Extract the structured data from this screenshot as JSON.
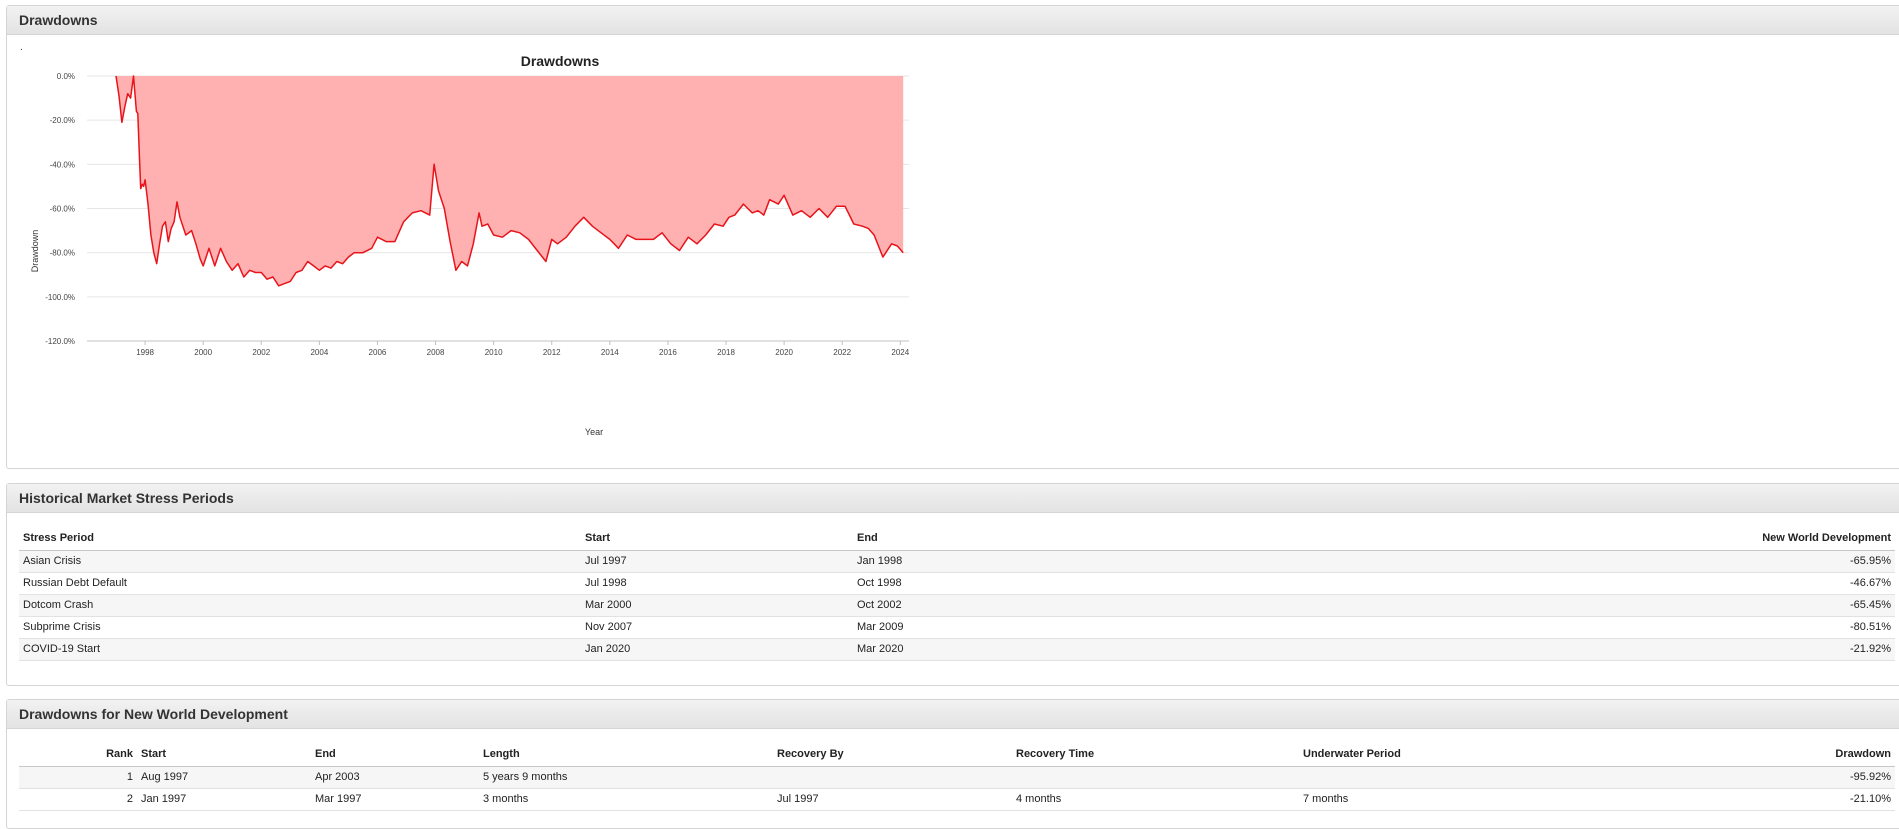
{
  "panels": {
    "drawdowns_title": "Drawdowns",
    "stress_title": "Historical Market Stress Periods",
    "dd_table_title": "Drawdowns for New World Development"
  },
  "chart_marker": ".",
  "chart_data": {
    "type": "area",
    "title": "Drawdowns",
    "xlabel": "Year",
    "ylabel": "Drawdown",
    "ylim": [
      -120,
      0
    ],
    "xlim": [
      1996.0,
      2024.3
    ],
    "y_ticks": [
      0,
      -20,
      -40,
      -60,
      -80,
      -100,
      -120
    ],
    "y_tick_labels": [
      "0.0%",
      "-20.0%",
      "-40.0%",
      "-60.0%",
      "-80.0%",
      "-100.0%",
      "-120.0%"
    ],
    "x_ticks": [
      1998,
      2000,
      2002,
      2004,
      2006,
      2008,
      2010,
      2012,
      2014,
      2016,
      2018,
      2020,
      2022,
      2024
    ],
    "x_tick_labels": [
      "1998",
      "2000",
      "2002",
      "2004",
      "2006",
      "2008",
      "2010",
      "2012",
      "2014",
      "2016",
      "2018",
      "2020",
      "2022",
      "2024"
    ],
    "grid": true,
    "line_color": "#e8141b",
    "fill_color": "#ffb0b0",
    "series": [
      {
        "x": [
          1997.0,
          1997.1,
          1997.2,
          1997.3,
          1997.4,
          1997.5,
          1997.6,
          1997.7,
          1997.75,
          1997.8,
          1997.85,
          1997.9,
          1997.95,
          1998.0,
          1998.1,
          1998.2,
          1998.3,
          1998.4,
          1998.5,
          1998.6,
          1998.7,
          1998.8,
          1998.9,
          1999.0,
          1999.1,
          1999.2,
          1999.4,
          1999.6,
          1999.75,
          1999.9,
          2000.0,
          2000.2,
          2000.4,
          2000.6,
          2000.8,
          2001.0,
          2001.2,
          2001.4,
          2001.6,
          2001.8,
          2002.0,
          2002.2,
          2002.4,
          2002.6,
          2002.8,
          2003.0,
          2003.2,
          2003.4,
          2003.6,
          2003.8,
          2004.0,
          2004.2,
          2004.4,
          2004.6,
          2004.8,
          2005.0,
          2005.2,
          2005.5,
          2005.8,
          2006.0,
          2006.3,
          2006.6,
          2006.9,
          2007.2,
          2007.5,
          2007.8,
          2007.95,
          2008.1,
          2008.3,
          2008.5,
          2008.7,
          2008.9,
          2009.1,
          2009.3,
          2009.5,
          2009.6,
          2009.8,
          2010.0,
          2010.3,
          2010.6,
          2010.9,
          2011.2,
          2011.5,
          2011.8,
          2012.0,
          2012.2,
          2012.5,
          2012.8,
          2013.1,
          2013.4,
          2013.7,
          2014.0,
          2014.3,
          2014.6,
          2014.9,
          2015.2,
          2015.5,
          2015.8,
          2016.1,
          2016.4,
          2016.7,
          2017.0,
          2017.3,
          2017.6,
          2017.9,
          2018.1,
          2018.3,
          2018.6,
          2018.9,
          2019.1,
          2019.3,
          2019.5,
          2019.8,
          2020.0,
          2020.3,
          2020.6,
          2020.9,
          2021.2,
          2021.5,
          2021.8,
          2022.1,
          2022.4,
          2022.7,
          2022.9,
          2023.1,
          2023.4,
          2023.7,
          2023.9,
          2024.1
        ],
        "y": [
          0,
          -9,
          -21,
          -14,
          -8,
          -10,
          0,
          -16,
          -17,
          -35,
          -51,
          -49,
          -50,
          -47,
          -58,
          -72,
          -80,
          -85,
          -76,
          -68,
          -66,
          -75,
          -69,
          -66,
          -57,
          -64,
          -72,
          -70,
          -76,
          -83,
          -86,
          -78,
          -86,
          -78,
          -84,
          -88,
          -85,
          -91,
          -88,
          -89,
          -89,
          -92,
          -91,
          -95,
          -94,
          -93,
          -89,
          -88,
          -84,
          -86,
          -88,
          -86,
          -87,
          -84,
          -85,
          -82,
          -80,
          -80,
          -78,
          -73,
          -75,
          -75,
          -66,
          -62,
          -61,
          -63,
          -40,
          -52,
          -60,
          -75,
          -88,
          -84,
          -86,
          -76,
          -62,
          -68,
          -67,
          -72,
          -73,
          -70,
          -71,
          -74,
          -79,
          -84,
          -74,
          -76,
          -73,
          -68,
          -64,
          -68,
          -71,
          -74,
          -78,
          -72,
          -74,
          -74,
          -74,
          -71,
          -76,
          -79,
          -73,
          -76,
          -72,
          -67,
          -68,
          -64,
          -63,
          -58,
          -62,
          -61,
          -63,
          -56,
          -58,
          -54,
          -63,
          -61,
          -64,
          -60,
          -64,
          -59,
          -59,
          -67,
          -68,
          -69,
          -72,
          -82,
          -76,
          -77,
          -80
        ]
      }
    ]
  },
  "stress_table": {
    "headers": [
      "Stress Period",
      "Start",
      "End",
      "New World Development"
    ],
    "rows": [
      [
        "Asian Crisis",
        "Jul 1997",
        "Jan 1998",
        "-65.95%"
      ],
      [
        "Russian Debt Default",
        "Jul 1998",
        "Oct 1998",
        "-46.67%"
      ],
      [
        "Dotcom Crash",
        "Mar 2000",
        "Oct 2002",
        "-65.45%"
      ],
      [
        "Subprime Crisis",
        "Nov 2007",
        "Mar 2009",
        "-80.51%"
      ],
      [
        "COVID-19 Start",
        "Jan 2020",
        "Mar 2020",
        "-21.92%"
      ]
    ]
  },
  "drawdown_table": {
    "headers": [
      "Rank",
      "Start",
      "End",
      "Length",
      "Recovery By",
      "Recovery Time",
      "Underwater Period",
      "Drawdown"
    ],
    "rows": [
      [
        "1",
        "Aug 1997",
        "Apr 2003",
        "5 years 9 months",
        "",
        "",
        "",
        "-95.92%"
      ],
      [
        "2",
        "Jan 1997",
        "Mar 1997",
        "3 months",
        "Jul 1997",
        "4 months",
        "7 months",
        "-21.10%"
      ]
    ]
  }
}
